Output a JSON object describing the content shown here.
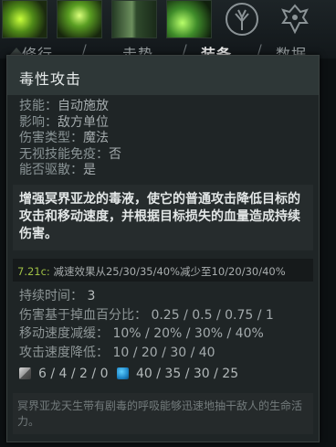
{
  "tabs": {
    "items": [
      {
        "label": "修行"
      },
      {
        "label": "走势"
      },
      {
        "label": "装备"
      },
      {
        "label": "数据"
      }
    ],
    "separator": "/"
  },
  "tooltip": {
    "title": "毒性攻击",
    "properties": [
      {
        "key": "技能：",
        "value": "自动施放"
      },
      {
        "key": "影响：",
        "value": "敌方单位"
      },
      {
        "key": "伤害类型：",
        "value": "魔法"
      },
      {
        "key": "无视技能免疫：",
        "value": "否"
      },
      {
        "key": "能否驱散：",
        "value": "是"
      }
    ],
    "description": "增强冥界亚龙的毒液，使它的普通攻击降低目标的攻击和移动速度，并根据目标损失的血量造成持续伤害。",
    "patch_version": "7.21c:",
    "patch_note": "减速效果从25/30/35/40%减少至10/20/30/40%",
    "stats": [
      {
        "key": "持续时间：",
        "value": "3"
      },
      {
        "key": "伤害基于掉血百分比：",
        "value": "0.25 / 0.5 / 0.75 / 1"
      },
      {
        "key": "移动速度减缓：",
        "value": "10% / 20% / 30% / 40%"
      },
      {
        "key": "攻击速度降低：",
        "value": "10 / 20 / 30 / 40"
      }
    ],
    "cooldown": "6 / 4 / 2 / 0",
    "mana_cost": "40 / 35 / 30 / 25",
    "lore": "冥界亚龙天生带有剧毒的呼吸能够迅速地抽干敌人的生命活力。"
  },
  "colors": {
    "panel_bg": "#1f2526",
    "title_bg": "#2e3737",
    "patch_version": "#9fbf45",
    "mana": "#1e86c8"
  },
  "icons": [
    "ability-1-icon",
    "ability-2-icon",
    "ability-3-icon",
    "ability-4-icon",
    "talent-tree-icon",
    "aghanim-icon",
    "cooldown-icon",
    "mana-icon"
  ]
}
